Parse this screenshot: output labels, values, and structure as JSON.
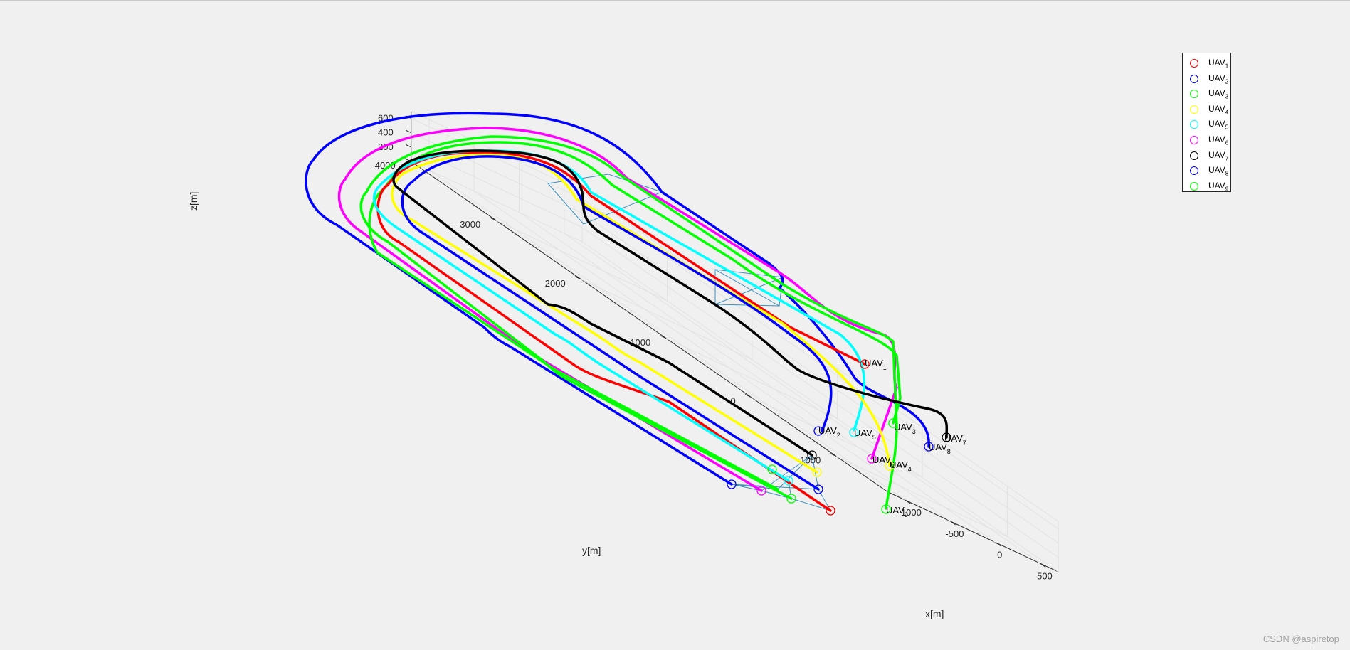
{
  "chart_data": {
    "type": "line",
    "title": "",
    "xlabel": "x[m]",
    "ylabel": "y[m]",
    "zlabel": "z[m]",
    "x_ticks": [
      "-1000",
      "-500",
      "0",
      "500"
    ],
    "y_ticks": [
      "-1000",
      "0",
      "1000",
      "2000",
      "3000",
      "4000"
    ],
    "z_ticks": [
      "200",
      "400",
      "600"
    ],
    "xlim": [
      -1200,
      700
    ],
    "ylim": [
      -1600,
      4000
    ],
    "zlim": [
      0,
      700
    ],
    "grid": true,
    "legend_position": "top-right",
    "series": [
      {
        "name": "UAV1",
        "label_main": "UAV",
        "label_sub": "1",
        "color": "#ff0000"
      },
      {
        "name": "UAV2",
        "label_main": "UAV",
        "label_sub": "2",
        "color": "#0000ff"
      },
      {
        "name": "UAV3",
        "label_main": "UAV",
        "label_sub": "3",
        "color": "#00ff00"
      },
      {
        "name": "UAV4",
        "label_main": "UAV",
        "label_sub": "4",
        "color": "#ffff00"
      },
      {
        "name": "UAV5",
        "label_main": "UAV",
        "label_sub": "5",
        "color": "#00ffff"
      },
      {
        "name": "UAV6",
        "label_main": "UAV",
        "label_sub": "6",
        "color": "#ff00ff"
      },
      {
        "name": "UAV7",
        "label_main": "UAV",
        "label_sub": "7",
        "color": "#000000"
      },
      {
        "name": "UAV8",
        "label_main": "UAV",
        "label_sub": "8",
        "color": "#0000ff"
      },
      {
        "name": "UAV9",
        "label_main": "UAV",
        "label_sub": "9",
        "color": "#00ff00"
      }
    ]
  },
  "watermark": "CSDN @aspiretop"
}
